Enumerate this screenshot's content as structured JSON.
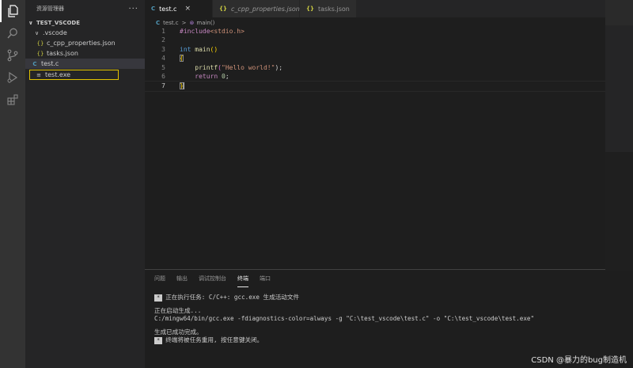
{
  "activity_bar": [
    "files-icon",
    "search-icon",
    "source-control-icon",
    "run-debug-icon",
    "extensions-icon"
  ],
  "sidebar": {
    "title": "资源管理器",
    "more": "···",
    "folder": "TEST_VSCODE",
    "items": [
      {
        "label": ".vscode",
        "icon": "chevron",
        "glyph": "∨"
      },
      {
        "label": "c_cpp_properties.json",
        "icon": "json",
        "glyph": "{}"
      },
      {
        "label": "tasks.json",
        "icon": "json",
        "glyph": "{}"
      },
      {
        "label": "test.c",
        "icon": "c",
        "glyph": "C"
      },
      {
        "label": "test.exe",
        "icon": "exe",
        "glyph": "≡"
      }
    ]
  },
  "tabs": [
    {
      "label": "test.c",
      "glyph": "C",
      "close": "×"
    },
    {
      "label": "c_cpp_properties.json",
      "glyph": "{}"
    },
    {
      "label": "tasks.json",
      "glyph": "{}"
    }
  ],
  "breadcrumb": {
    "file": "test.c",
    "glyph": "C",
    "sep": ">",
    "symbol_glyph": "⊛",
    "symbol": "main()"
  },
  "code": {
    "line_numbers": [
      "1",
      "2",
      "3",
      "4",
      "5",
      "6",
      "7"
    ],
    "l1_directive": "#include",
    "l1_header": "<stdio.h>",
    "l3_type": "int",
    "l3_name": "main",
    "l3_parens": "()",
    "l4_brace": "{",
    "l5_indent": "    ",
    "l5_fn": "printf",
    "l5_open": "(",
    "l5_string": "\"Hello world!\"",
    "l5_close": ");",
    "l6_indent": "    ",
    "l6_kw": "return",
    "l6_num": "0",
    "l6_semi": ";",
    "l7_brace": "}"
  },
  "panel": {
    "tabs": [
      "问题",
      "输出",
      "调试控制台",
      "终端",
      "端口"
    ],
    "active_tab": "终端",
    "star": "*",
    "lines": {
      "t1": "正在执行任务: C/C++: gcc.exe 生成活动文件",
      "t2": "正在启动生成...",
      "t3": "C:/mingw64/bin/gcc.exe -fdiagnostics-color=always -g \"C:\\test_vscode\\test.c\" -o \"C:\\test_vscode\\test.exe\"",
      "t4": "生成已成功完成。",
      "t5": "终端将被任务重用, 按任意键关闭。"
    }
  },
  "watermark": "CSDN @暴力的bug制造机"
}
